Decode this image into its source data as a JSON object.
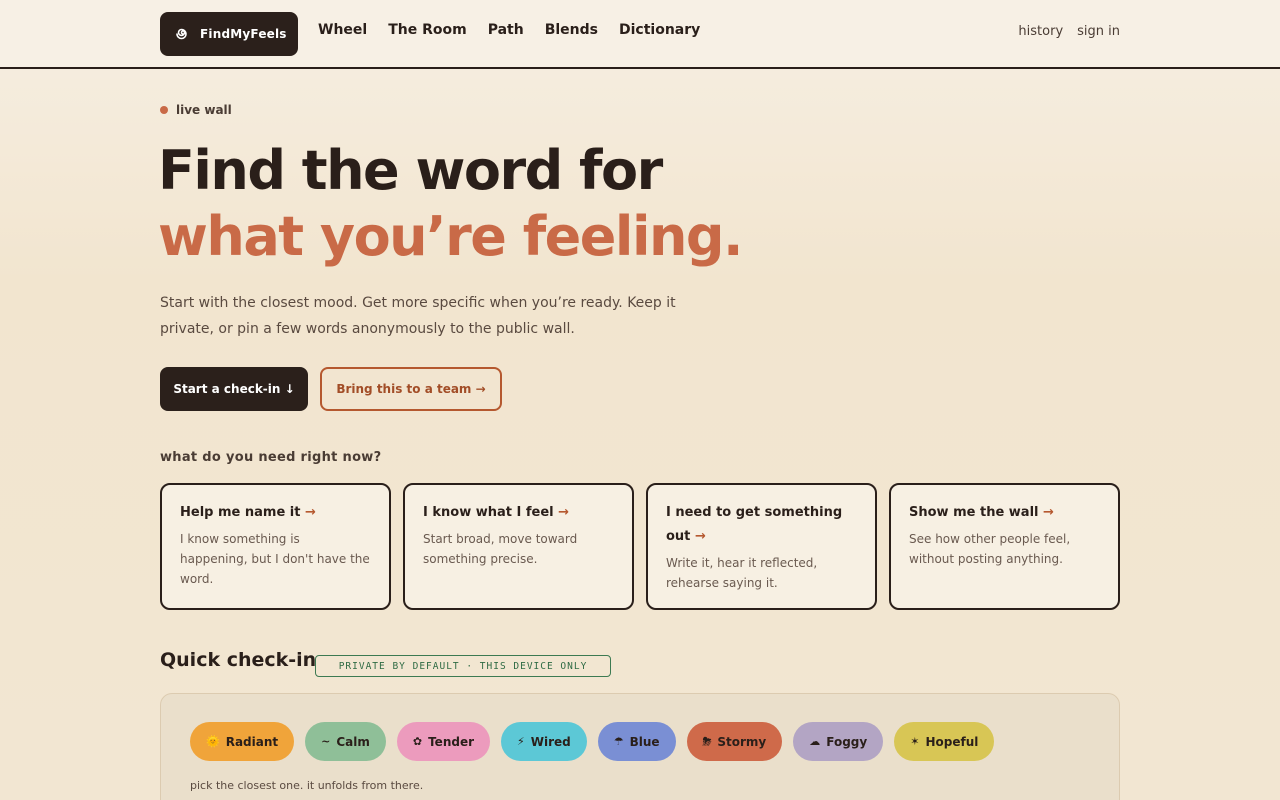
{
  "header": {
    "logo_text": "FindMyFeels",
    "nav": [
      "Wheel",
      "The Room",
      "Path",
      "Blends",
      "Dictionary"
    ],
    "history_label": "history",
    "signin_label": "sign in"
  },
  "hero": {
    "live_label": "live wall",
    "title_line1": "Find the word for",
    "title_line2": "what you’re feeling.",
    "lead": "Start with the closest mood. Get more specific when you’re ready. Keep it private, or pin a few words anonymously to the public wall.",
    "primary_button": "Start a check-in ↓",
    "secondary_button": "Bring this to a team →"
  },
  "needs": {
    "label": "what do you need right now?",
    "cards": [
      {
        "title": "Help me name it",
        "desc": "I know something is happening, but I don't have the word."
      },
      {
        "title": "I know what I feel",
        "desc": "Start broad, move toward something precise."
      },
      {
        "title": "I need to get something out",
        "desc": "Write it, hear it reflected, rehearse saying it."
      },
      {
        "title": "Show me the wall",
        "desc": "See how other people feel, without posting anything."
      }
    ],
    "arrow": "→"
  },
  "quick_checkin": {
    "title": "Quick check-in",
    "badge": "PRIVATE BY DEFAULT · THIS DEVICE ONLY",
    "hint": "pick the closest one. it unfolds from there.",
    "moods": [
      {
        "label": "Radiant",
        "icon": "🌞",
        "color": "#f0a43a"
      },
      {
        "label": "Calm",
        "icon": "~",
        "color": "#8fbf98"
      },
      {
        "label": "Tender",
        "icon": "✿",
        "color": "#ec9bbd"
      },
      {
        "label": "Wired",
        "icon": "⚡",
        "color": "#5cc8d6"
      },
      {
        "label": "Blue",
        "icon": "☂",
        "color": "#7a8fd4"
      },
      {
        "label": "Stormy",
        "icon": "⛈",
        "color": "#cf6a4a"
      },
      {
        "label": "Foggy",
        "icon": "☁",
        "color": "#b3a5c4"
      },
      {
        "label": "Hopeful",
        "icon": "✶",
        "color": "#d8c655"
      }
    ]
  }
}
